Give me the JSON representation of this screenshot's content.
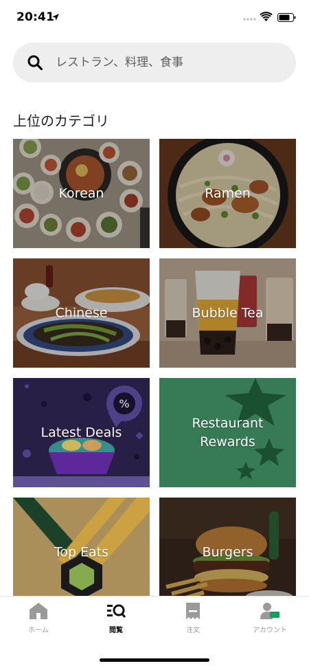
{
  "status_bar": {
    "time": "20:41"
  },
  "search": {
    "placeholder": "レストラン、料理、食事"
  },
  "section": {
    "title": "上位のカテゴリ"
  },
  "categories": [
    {
      "label": "Korean"
    },
    {
      "label": "Ramen"
    },
    {
      "label": "Chinese"
    },
    {
      "label": "Bubble Tea"
    },
    {
      "label": "Latest Deals"
    },
    {
      "label": "Restaurant Rewards"
    },
    {
      "label": "Top Eats"
    },
    {
      "label": "Burgers"
    }
  ],
  "tabs": [
    {
      "label": "ホーム",
      "icon": "home-icon",
      "active": false
    },
    {
      "label": "閲覧",
      "icon": "browse-icon",
      "active": true
    },
    {
      "label": "注文",
      "icon": "receipt-icon",
      "active": false
    },
    {
      "label": "アカウント",
      "icon": "account-icon",
      "active": false
    }
  ],
  "colors": {
    "deals_bg": "#2e2451",
    "rewards_bg": "#3e8a60",
    "top_eats_bg": "#d9a944"
  }
}
